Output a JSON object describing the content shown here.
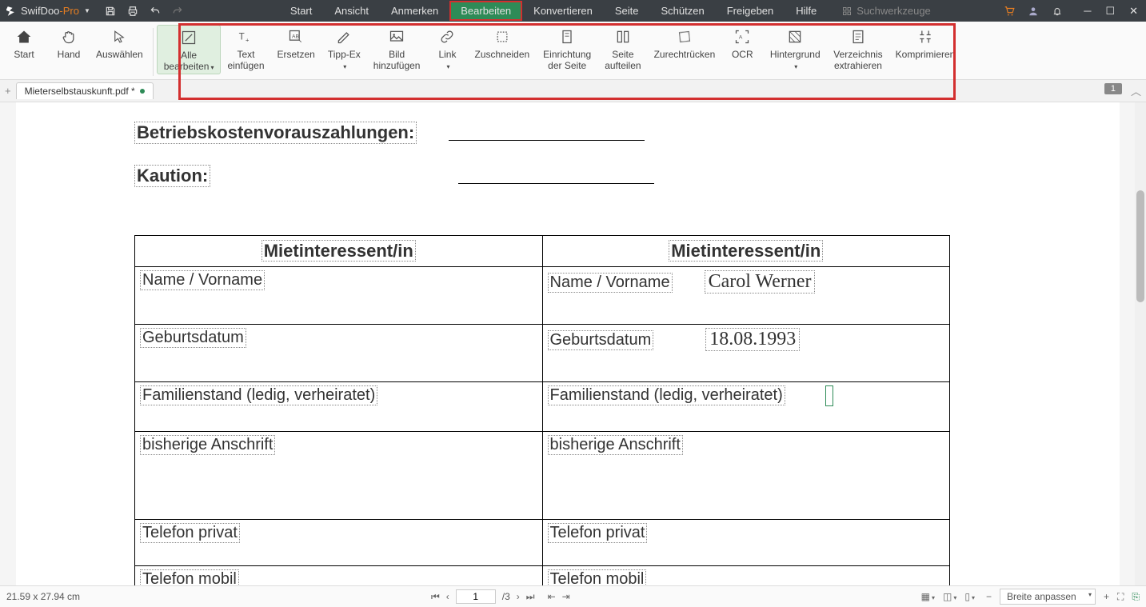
{
  "brand": {
    "name1": "SwifDoo",
    "name2": "-Pro"
  },
  "menu": {
    "start": "Start",
    "ansicht": "Ansicht",
    "anmerken": "Anmerken",
    "bearbeiten": "Bearbeiten",
    "konvertieren": "Konvertieren",
    "seite": "Seite",
    "schuetzen": "Schützen",
    "freigeben": "Freigeben",
    "hilfe": "Hilfe"
  },
  "search_placeholder": "Suchwerkzeuge",
  "toolbar": {
    "start": "Start",
    "hand": "Hand",
    "auswaehlen": "Auswählen",
    "alle_bearbeiten": "Alle\nbearbeiten",
    "text_einfuegen": "Text\neinfügen",
    "ersetzen": "Ersetzen",
    "tipp_ex": "Tipp-Ex",
    "bild_hinzufuegen": "Bild\nhinzufügen",
    "link": "Link",
    "zuschneiden": "Zuschneiden",
    "einrichtung": "Einrichtung\nder Seite",
    "seite_aufteilen": "Seite\naufteilen",
    "zurueckruecken": "Zurechtrücken",
    "ocr": "OCR",
    "hintergrund": "Hintergrund",
    "verzeichnis": "Verzeichnis\nextrahieren",
    "komprimieren": "Komprimieren"
  },
  "tab": {
    "filename": "Mieterselbstauskunft.pdf *"
  },
  "page_badge": "1",
  "document": {
    "label_betriebskosten": "Betriebskostenvorauszahlungen:",
    "label_kaution": "Kaution:",
    "table_header": "Mietinteressent/in",
    "rows": {
      "name": "Name / Vorname",
      "geburtsdatum": "Geburtsdatum",
      "familienstand": "Familienstand (ledig, verheiratet)",
      "anschrift": "bisherige Anschrift",
      "telefon_privat": "Telefon privat",
      "telefon_mobil": "Telefon mobil"
    },
    "values": {
      "name2": "Carol Werner",
      "geburtsdatum2": "18.08.1993"
    }
  },
  "status": {
    "dimensions": "21.59 x 27.94 cm",
    "page_current": "1",
    "page_total": "/3",
    "zoom_label": "Breite anpassen"
  }
}
